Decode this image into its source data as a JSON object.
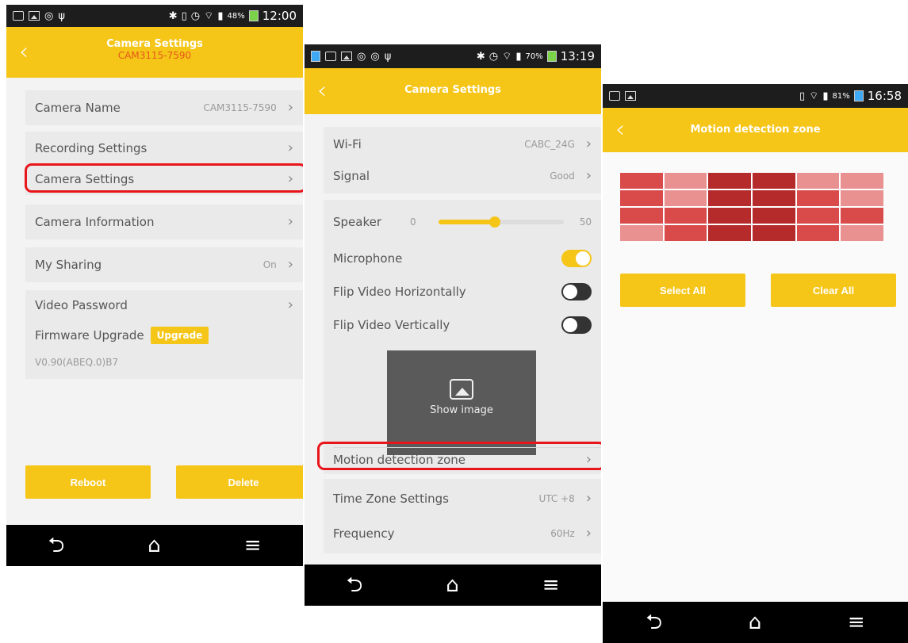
{
  "screen1": {
    "status": {
      "battery": "48%",
      "time": "12:00"
    },
    "header": {
      "title": "Camera Settings",
      "subtitle": "CAM3115-7590"
    },
    "camera_name": {
      "label": "Camera Name",
      "value": "CAM3115-7590"
    },
    "recording_settings": "Recording Settings",
    "camera_settings": "Camera Settings",
    "camera_information": "Camera Information",
    "my_sharing": {
      "label": "My Sharing",
      "value": "On"
    },
    "video_password": "Video Password",
    "firmware": {
      "label": "Firmware Upgrade",
      "button": "Upgrade",
      "version": "V0.90(ABEQ.0)B7"
    },
    "buttons": {
      "reboot": "Reboot",
      "delete": "Delete"
    }
  },
  "screen2": {
    "status": {
      "battery": "70%",
      "time": "13:19"
    },
    "header": {
      "title": "Camera Settings"
    },
    "wifi": {
      "label": "Wi-Fi",
      "value": "CABC_24G"
    },
    "signal": {
      "label": "Signal",
      "value": "Good"
    },
    "speaker": {
      "label": "Speaker",
      "min": "0",
      "max": "50",
      "level": 0.45
    },
    "microphone": {
      "label": "Microphone",
      "on": true
    },
    "flip_h": {
      "label": "Flip Video Horizontally",
      "on": false
    },
    "flip_v": {
      "label": "Flip Video Vertically",
      "on": false
    },
    "show_image": "Show image",
    "motion_zone": "Motion detection zone",
    "time_zone": {
      "label": "Time Zone Settings",
      "value": "UTC +8"
    },
    "frequency": {
      "label": "Frequency",
      "value": "60Hz"
    }
  },
  "screen3": {
    "status": {
      "battery": "81%",
      "time": "16:58"
    },
    "header": {
      "title": "Motion detection zone"
    },
    "buttons": {
      "select_all": "Select All",
      "clear_all": "Clear All"
    }
  },
  "navbar": {
    "back": "⮌",
    "home": "⌂",
    "menu": "≡"
  },
  "colors": {
    "accent": "#f5c518",
    "highlight": "#e8151b",
    "subtitle": "#e6581a"
  }
}
